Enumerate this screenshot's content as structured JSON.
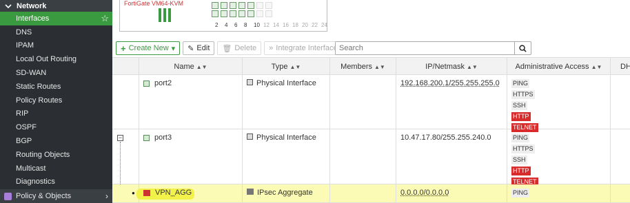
{
  "sidebar": {
    "section": "Network",
    "items": [
      {
        "label": "Interfaces",
        "active": true
      },
      {
        "label": "DNS"
      },
      {
        "label": "IPAM"
      },
      {
        "label": "Local Out Routing"
      },
      {
        "label": "SD-WAN"
      },
      {
        "label": "Static Routes"
      },
      {
        "label": "Policy Routes"
      },
      {
        "label": "RIP"
      },
      {
        "label": "OSPF"
      },
      {
        "label": "BGP"
      },
      {
        "label": "Routing Objects"
      },
      {
        "label": "Multicast"
      },
      {
        "label": "Diagnostics"
      }
    ],
    "bottom": "Policy & Objects"
  },
  "device": {
    "title": "FortiGate VM64-KVM",
    "port_numbers": [
      "2",
      "4",
      "6",
      "8",
      "10",
      "12",
      "14",
      "16",
      "18",
      "20",
      "22",
      "24"
    ]
  },
  "toolbar": {
    "create_new": "Create New",
    "edit": "Edit",
    "delete": "Delete",
    "integrate": "Integrate Interface",
    "search_placeholder": "Search"
  },
  "table": {
    "headers": [
      "Name",
      "Type",
      "Members",
      "IP/Netmask",
      "Administrative Access",
      "DH"
    ],
    "rows": [
      {
        "name": "port2",
        "type": "Physical Interface",
        "members": "",
        "ip": "192.168.200.1/255.255.255.0",
        "access": [
          "PING",
          "HTTPS",
          "SSH",
          "HTTP",
          "TELNET"
        ]
      },
      {
        "name": "port3",
        "type": "Physical Interface",
        "members": "",
        "ip": "10.47.17.80/255.255.240.0",
        "access": [
          "PING",
          "HTTPS",
          "SSH",
          "HTTP",
          "TELNET"
        ]
      },
      {
        "name": "VPN_AGG",
        "type": "IPsec Aggregate",
        "members": "",
        "ip": "0.0.0.0/0.0.0.0",
        "access": [
          "PING"
        ]
      }
    ]
  },
  "colors": {
    "accent": "#3a9a3f",
    "danger": "#d82c2c",
    "highlight": "#f3f24a"
  }
}
